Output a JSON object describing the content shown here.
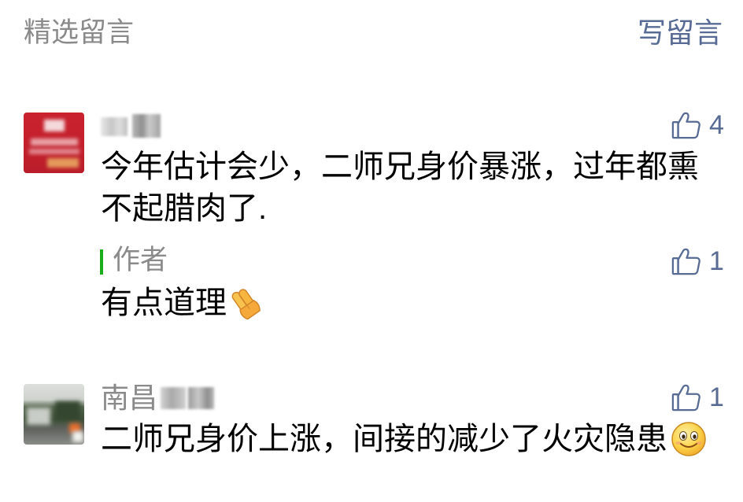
{
  "header": {
    "title": "精选留言",
    "write_label": "写留言"
  },
  "colors": {
    "accent": "#576b95",
    "meta": "#8a8a8a",
    "text": "#000000",
    "author_bar": "#1aad19"
  },
  "like_icon": "thumbs-up-icon",
  "comments": [
    {
      "likes": 4,
      "text": "今年估计会少，二师兄身价暴涨，过年都熏不起腊肉了.",
      "reply": {
        "author_label": "作者",
        "likes": 1,
        "text": "有点道理",
        "emoji": "folded-hands-icon"
      }
    },
    {
      "username": "南昌",
      "likes": 1,
      "text": "二师兄身价上涨，间接的减少了火灾隐患",
      "emoji": "smiley-icon"
    }
  ]
}
